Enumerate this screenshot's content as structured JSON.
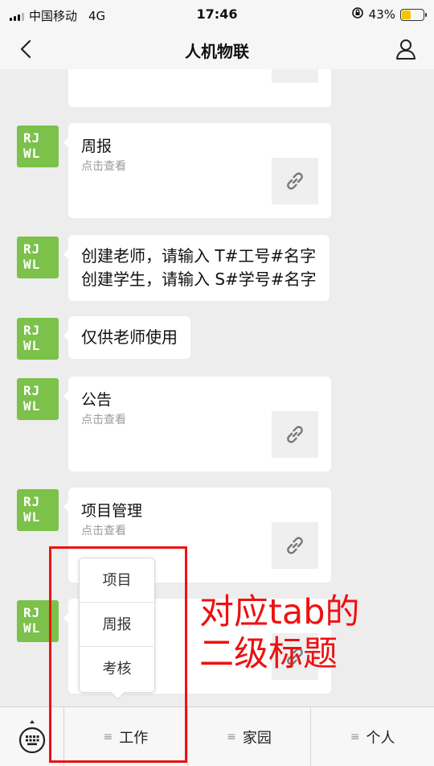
{
  "status": {
    "carrier": "中国移动",
    "network": "4G",
    "time": "17:46",
    "battery": "43%",
    "battery_level": 0.43
  },
  "nav": {
    "title": "人机物联"
  },
  "avatar_text": [
    "RJ",
    "WL"
  ],
  "messages": {
    "weekly": {
      "title": "周报",
      "subtitle": "点击查看"
    },
    "create_text": "创建老师，请输入 T#工号#名字\n创建学生，请输入 S#学号#名字",
    "teacher_only": "仅供老师使用",
    "notice": {
      "title": "公告",
      "subtitle": "点击查看"
    },
    "project": {
      "title": "项目管理",
      "subtitle": "点击查看"
    }
  },
  "popup": {
    "items": [
      "项目",
      "周报",
      "考核"
    ]
  },
  "tabbar": {
    "tabs": [
      "工作",
      "家园",
      "个人"
    ]
  },
  "annotation": {
    "text": "对应tab的\n二级标题"
  },
  "colors": {
    "avatar": "#7bc14a",
    "annotation": "#ee1111"
  }
}
